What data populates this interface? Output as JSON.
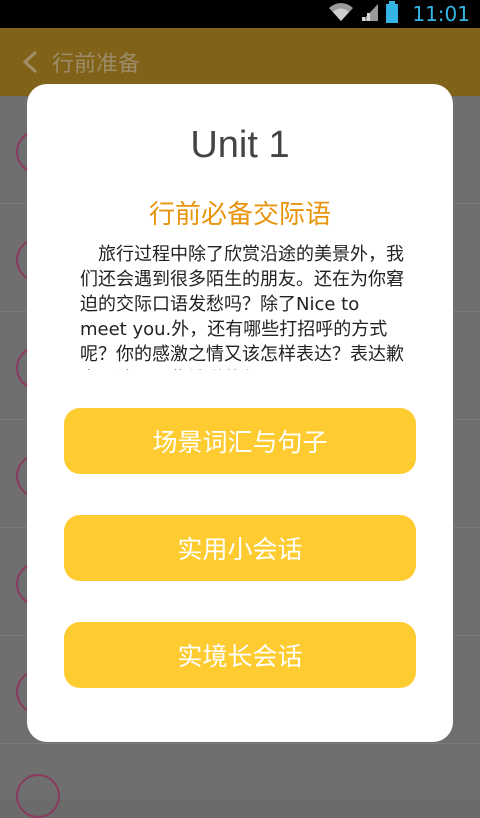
{
  "status_bar": {
    "time": "11:01"
  },
  "header": {
    "title": "行前准备"
  },
  "dialog": {
    "unit_title": "Unit 1",
    "subtitle": "行前必备交际语",
    "description": "　旅行过程中除了欣赏沿途的美景外，我们还会遇到很多陌生的朋友。还在为你窘迫的交际口语发愁吗？除了Nice to meet you.外，还有哪些打招呼的方式呢？你的感激之情又该怎样表达？表达歉意又该用哪些地道的句",
    "buttons": [
      {
        "label": "场景词汇与句子"
      },
      {
        "label": "实用小会话"
      },
      {
        "label": "实境长会话"
      }
    ]
  },
  "colors": {
    "accent": "#fecb30",
    "subtitle": "#e8940d",
    "status_time": "#33b5e5"
  }
}
